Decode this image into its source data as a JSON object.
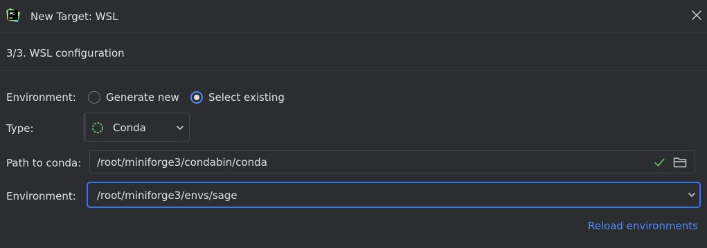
{
  "window": {
    "title": "New Target: WSL",
    "logo_icon": "pycharm-logo-icon",
    "close_icon": "close-icon"
  },
  "step": {
    "title": "3/3. WSL configuration"
  },
  "form": {
    "environment_mode": {
      "label": "Environment:",
      "options": [
        {
          "label": "Generate new",
          "selected": false
        },
        {
          "label": "Select existing",
          "selected": true
        }
      ]
    },
    "type": {
      "label": "Type:",
      "value": "Conda",
      "icon": "conda-icon"
    },
    "path_to_conda": {
      "label": "Path to conda:",
      "value": "/root/miniforge3/condabin/conda",
      "valid_icon": "check-icon",
      "browse_icon": "folder-icon"
    },
    "environment": {
      "label": "Environment:",
      "value": "/root/miniforge3/envs/sage"
    },
    "reload_link": "Reload environments"
  },
  "colors": {
    "background": "#2b2d30",
    "accent": "#548af7",
    "focus_border": "#3574f0",
    "valid_green": "#5fb865"
  }
}
